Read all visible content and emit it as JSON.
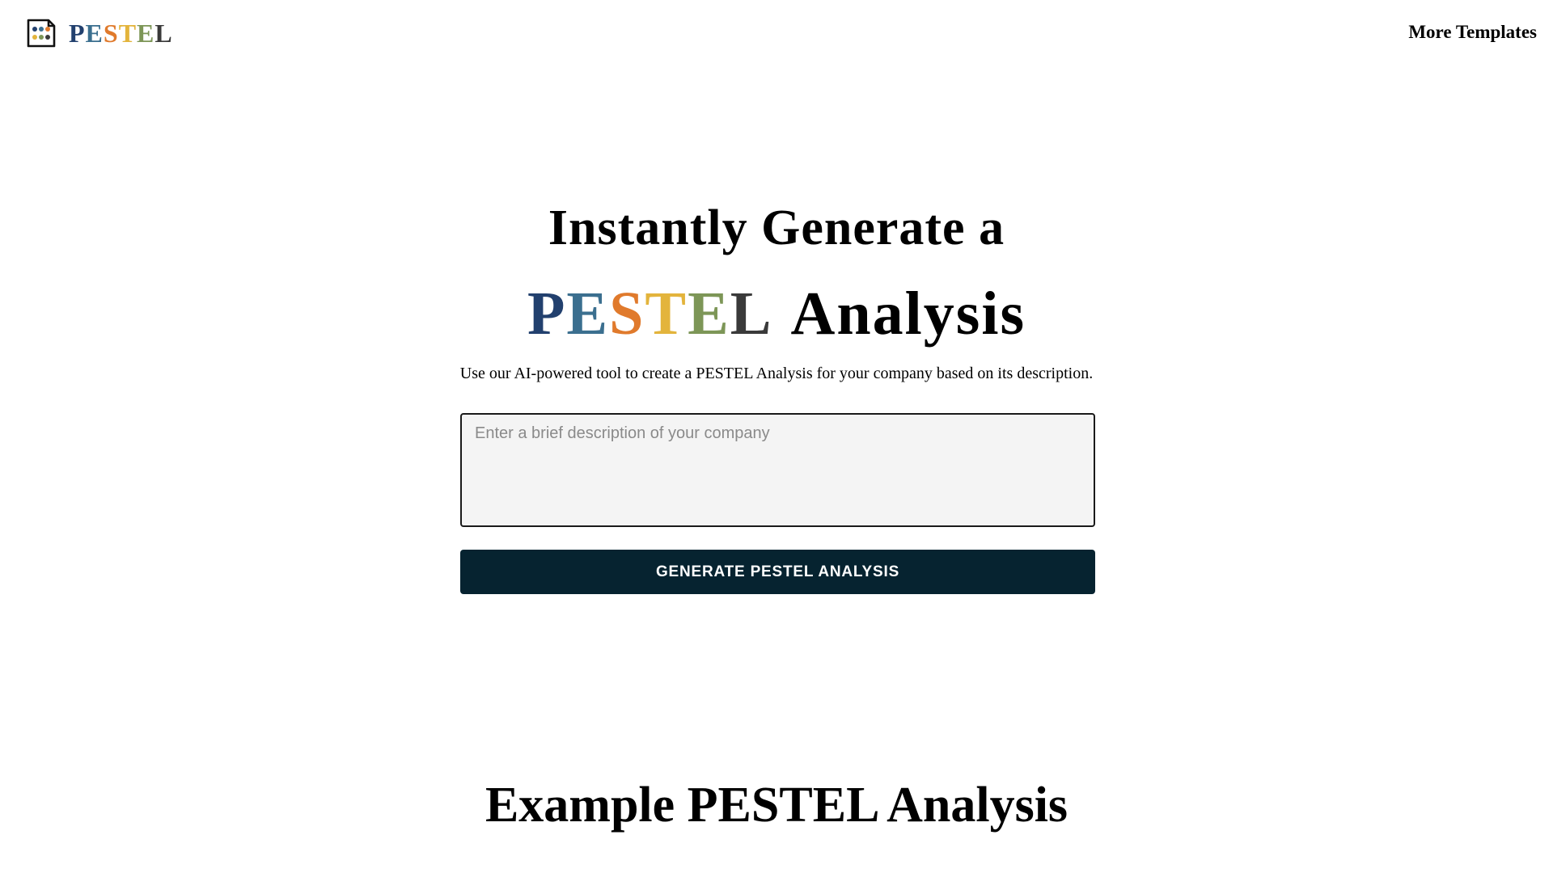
{
  "header": {
    "brand": {
      "letters": [
        {
          "char": "P",
          "color": "#22406e"
        },
        {
          "char": "E",
          "color": "#3b6f8f"
        },
        {
          "char": "S",
          "color": "#e07a2c"
        },
        {
          "char": "T",
          "color": "#e3b43c"
        },
        {
          "char": "E",
          "color": "#7d9657"
        },
        {
          "char": "L",
          "color": "#3a3a3a"
        }
      ],
      "logo_icon": "grid-dots-icon"
    },
    "nav_link": "More Templates"
  },
  "hero": {
    "line1": "Instantly Generate a",
    "pestel_letters": [
      {
        "char": "P",
        "color": "#22406e"
      },
      {
        "char": "E",
        "color": "#3b6f8f"
      },
      {
        "char": "S",
        "color": "#e07a2c"
      },
      {
        "char": "T",
        "color": "#e3b43c"
      },
      {
        "char": "E",
        "color": "#7d9657"
      },
      {
        "char": "L",
        "color": "#3a3a3a"
      }
    ],
    "line2_suffix": "Analysis",
    "subtitle": "Use our AI-powered tool to create a PESTEL Analysis for your company based on its description."
  },
  "form": {
    "description_placeholder": "Enter a brief description of your company",
    "description_value": "",
    "generate_label": "GENERATE PESTEL ANALYSIS"
  },
  "example": {
    "heading": "Example PESTEL Analysis"
  },
  "colors": {
    "button_bg": "#062330",
    "input_bg": "#f4f4f4"
  }
}
